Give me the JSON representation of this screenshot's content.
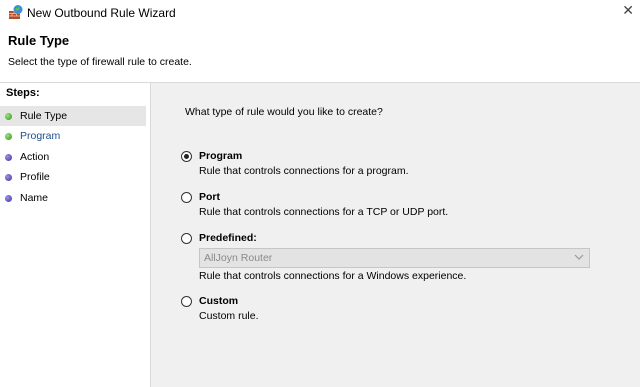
{
  "window": {
    "title": "New Outbound Rule Wizard",
    "close_glyph": "✕"
  },
  "header": {
    "title": "Rule Type",
    "subtitle": "Select the type of firewall rule to create."
  },
  "steps": {
    "label": "Steps:",
    "items": [
      {
        "label": "Rule Type",
        "status": "done",
        "active": true
      },
      {
        "label": "Program",
        "status": "done",
        "active": false
      },
      {
        "label": "Action",
        "status": "pending",
        "active": false
      },
      {
        "label": "Profile",
        "status": "pending",
        "active": false
      },
      {
        "label": "Name",
        "status": "pending",
        "active": false
      }
    ]
  },
  "main": {
    "question": "What type of rule would you like to create?",
    "options": [
      {
        "title": "Program",
        "description": "Rule that controls connections for a program.",
        "checked": true
      },
      {
        "title": "Port",
        "description": "Rule that controls connections for a TCP or UDP port.",
        "checked": false
      },
      {
        "title": "Predefined:",
        "description": "Rule that controls connections for a Windows experience.",
        "checked": false
      },
      {
        "title": "Custom",
        "description": "Custom rule.",
        "checked": false
      }
    ],
    "predefined_dropdown": {
      "selected": "AllJoyn Router",
      "enabled": false
    }
  },
  "colors": {
    "content_bg": "#f0f0f0",
    "step_done": "#2f8f1c",
    "step_pending": "#3a2fa0",
    "link_blue": "#1a4f8c"
  }
}
